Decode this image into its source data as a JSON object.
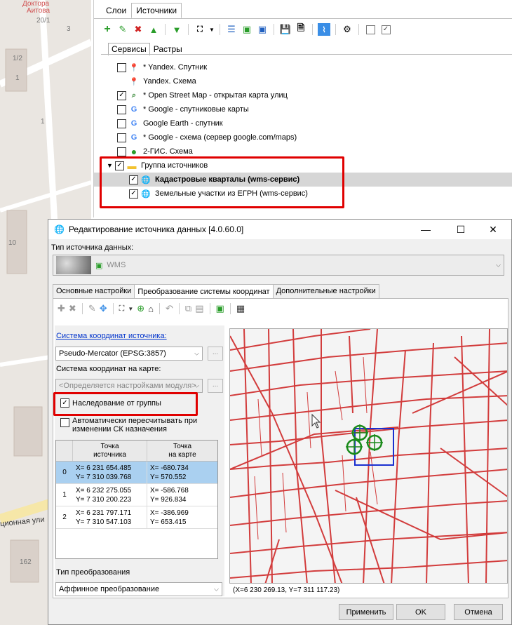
{
  "background_map": {
    "labels": [
      "Доктора",
      "Аитова",
      "20/1",
      "1/2",
      "1",
      "1",
      "3",
      "10",
      "ционная ули",
      "162"
    ]
  },
  "panel": {
    "tabs": [
      "Слои",
      "Источники"
    ],
    "active_tab": "Источники",
    "subtabs": [
      "Сервисы",
      "Растры"
    ],
    "sources": [
      {
        "label": "* Yandex. Спутник",
        "checked": false,
        "icon": "yandex-pin-icon"
      },
      {
        "label": "Yandex. Схема",
        "checked": null,
        "icon": "yandex-pin-icon"
      },
      {
        "label": "* Open Street Map - открытая карта улиц",
        "checked": true,
        "icon": "osm-icon"
      },
      {
        "label": "* Google - спутниковые карты",
        "checked": false,
        "icon": "google-icon"
      },
      {
        "label": "Google Earth - спутник",
        "checked": false,
        "icon": "google-icon"
      },
      {
        "label": "* Google - схема (сервер google.com/maps)",
        "checked": false,
        "icon": "google-icon"
      },
      {
        "label": "2-ГИС. Схема",
        "checked": false,
        "icon": "2gis-icon"
      },
      {
        "label": "Группа источников",
        "checked": true,
        "icon": "folder-icon"
      },
      {
        "label": "Кадастровые кварталы (wms-сервис)",
        "checked": true,
        "icon": "globe-icon",
        "selected": true
      },
      {
        "label": "Земельные участки из ЕГРН (wms-сервис)",
        "checked": true,
        "icon": "globe-icon"
      }
    ]
  },
  "dialog": {
    "title": "Редактирование источника данных [4.0.60.0]",
    "source_type_label": "Тип источника данных:",
    "source_type_value": "WMS",
    "tabs": [
      "Основные настройки",
      "Преобразование системы координат",
      "Дополнительные настройки"
    ],
    "active_tab": "Преобразование системы координат",
    "src_crs_label": "Система координат источника:",
    "src_crs_value": "Pseudo-Mercator (EPSG:3857)",
    "map_crs_label": "Система координат на карте:",
    "map_crs_value": "<Определяется настройками модуля>",
    "ellipsis": "...",
    "inherit_label": "Наследование от группы",
    "auto_recalc_label_1": "Автоматически пересчитывать при",
    "auto_recalc_label_2": "изменении СК назначения",
    "table": {
      "col1": [
        "Точка",
        "источника"
      ],
      "col2": [
        "Точка",
        "на карте"
      ],
      "rows": [
        {
          "n": "0",
          "sx": "X= 6 231 654.485",
          "sy": "Y= 7 310 039.768",
          "mx": "X= -680.734",
          "my": "Y= 570.552"
        },
        {
          "n": "1",
          "sx": "X= 6 232 275.055",
          "sy": "Y= 7 310 200.223",
          "mx": "X= -586.768",
          "my": "Y= 926.834"
        },
        {
          "n": "2",
          "sx": "X= 6 231 797.171",
          "sy": "Y= 7 310 547.103",
          "mx": "X= -386.969",
          "my": "Y= 653.415"
        }
      ]
    },
    "transform_label": "Тип преобразования",
    "transform_value": "Аффинное преобразование",
    "coords_readout": "(X=6 230 269.13, Y=7 311 117.23)",
    "btn_apply": "Применить",
    "btn_ok": "OK",
    "btn_cancel": "Отмена"
  },
  "colors": {
    "highlight": "#e00000",
    "selection": "#aad0f0",
    "map_lines": "#d23c3c"
  }
}
